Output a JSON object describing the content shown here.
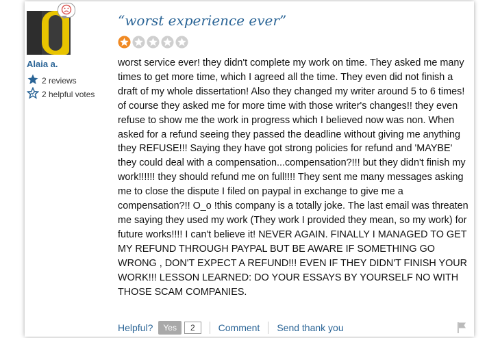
{
  "reviewer": {
    "name": "Alaia a.",
    "reviews": "2 reviews",
    "helpful_votes": "2 helpful votes"
  },
  "review": {
    "title": "“worst experience ever”",
    "rating": 1,
    "max_rating": 5,
    "text": "worst service ever! they didn't complete my work on time. They asked me many times to get more time, which I agreed all the time. They even did not finish a draft of my whole dissertation! Also they changed my writer around 5 to 6 times! of course they asked me for more time with those writer's changes!! they even refuse to show me the work in progress which I believed now was non. When asked for a refund seeing they passed the deadline without giving me anything they REFUSE!!! Saying they have got strong policies for refund and 'MAYBE' they could deal with a compensation...compensation?!!! but they didn't finish my work!!!!!! they should refund me on full!!!! They sent me many messages asking me to close the dispute I filed on paypal in exchange to give me a compensation?!! O_o !this company is a totally joke. The last email was threaten me saying they used my work (They work I provided they mean, so my work) for future works!!!! I can't believe it! NEVER AGAIN. FINALLY I MANAGED TO GET MY REFUND THROUGH PAYPAL BUT BE AWARE IF SOMETHING GO WRONG , DON'T EXPECT A REFUND!!! EVEN IF THEY DIDN'T FINISH YOUR WORK!!! LESSON LEARNED: DO YOUR ESSAYS BY YOURSELF NO WITH THOSE SCAM COMPANIES."
  },
  "footer": {
    "helpful_label": "Helpful?",
    "yes_label": "Yes",
    "yes_count": "2",
    "comment_label": "Comment",
    "send_thanks_label": "Send thank you"
  },
  "icons": {
    "sentiment": "frown-face-icon",
    "reviews": "star-icon",
    "votes": "star-outline-icon",
    "report": "flag-icon"
  },
  "colors": {
    "accent": "#2a6496",
    "star_filled": "#f08a24",
    "star_empty": "#cfcfcf"
  }
}
